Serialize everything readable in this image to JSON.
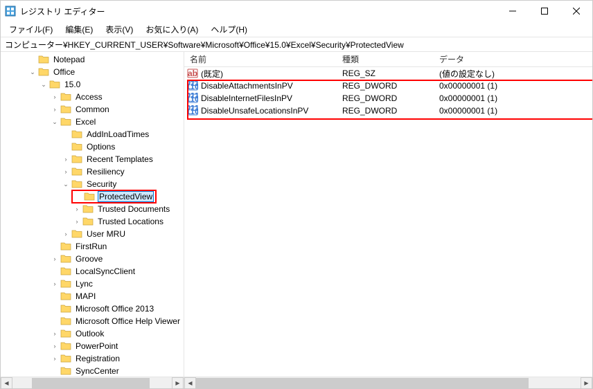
{
  "window": {
    "title": "レジストリ エディター"
  },
  "menu": {
    "file": "ファイル(F)",
    "edit": "編集(E)",
    "view": "表示(V)",
    "favorites": "お気に入り(A)",
    "help": "ヘルプ(H)"
  },
  "address": "コンピューター¥HKEY_CURRENT_USER¥Software¥Microsoft¥Office¥15.0¥Excel¥Security¥ProtectedView",
  "tree": {
    "notepad": "Notepad",
    "office": "Office",
    "v15": "15.0",
    "access": "Access",
    "common": "Common",
    "excel": "Excel",
    "addin": "AddInLoadTimes",
    "options": "Options",
    "recent": "Recent Templates",
    "resiliency": "Resiliency",
    "security": "Security",
    "protectedview": "ProtectedView",
    "trusteddocs": "Trusted Documents",
    "trustedlocs": "Trusted Locations",
    "usermru": "User MRU",
    "firstrun": "FirstRun",
    "groove": "Groove",
    "localsync": "LocalSyncClient",
    "lync": "Lync",
    "mapi": "MAPI",
    "mso2013": "Microsoft Office 2013",
    "msohelp": "Microsoft Office Help Viewer",
    "outlook": "Outlook",
    "powerpoint": "PowerPoint",
    "registration": "Registration",
    "synccenter": "SyncCenter"
  },
  "list": {
    "headers": {
      "name": "名前",
      "type": "種類",
      "data": "データ"
    },
    "rows": [
      {
        "name": "(既定)",
        "type": "REG_SZ",
        "data": "(値の設定なし)",
        "icon": "str"
      },
      {
        "name": "DisableAttachmentsInPV",
        "type": "REG_DWORD",
        "data": "0x00000001 (1)",
        "icon": "bin"
      },
      {
        "name": "DisableInternetFilesInPV",
        "type": "REG_DWORD",
        "data": "0x00000001 (1)",
        "icon": "bin"
      },
      {
        "name": "DisableUnsafeLocationsInPV",
        "type": "REG_DWORD",
        "data": "0x00000001 (1)",
        "icon": "bin"
      }
    ]
  }
}
